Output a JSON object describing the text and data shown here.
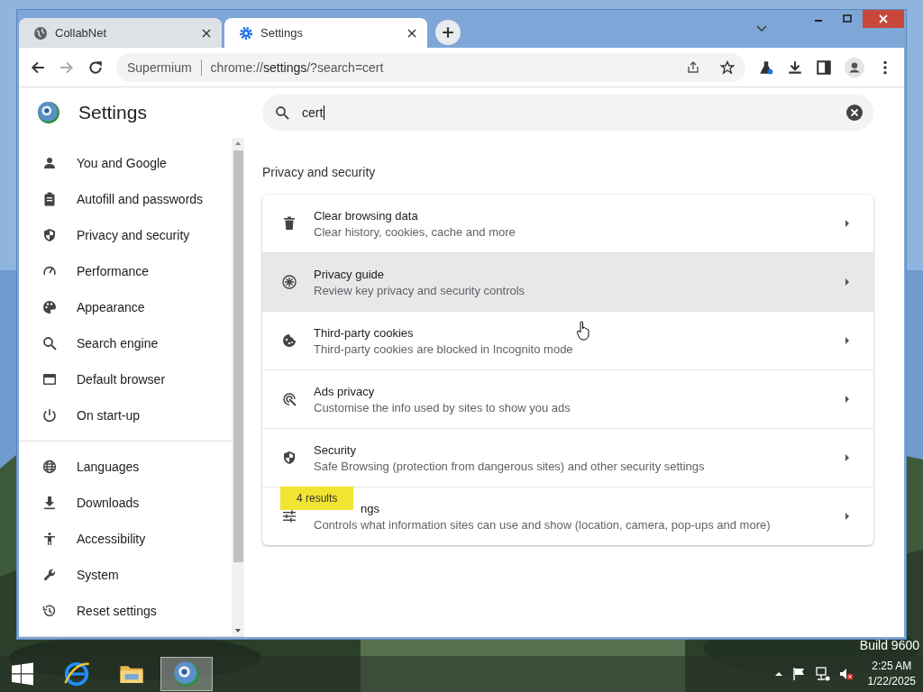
{
  "tabs": [
    {
      "title": "CollabNet",
      "selected": false
    },
    {
      "title": "Settings",
      "selected": true
    }
  ],
  "address_bar": {
    "site": "Supermium",
    "url_prefix": "chrome://",
    "url_host": "settings",
    "url_rest": "/?search=cert"
  },
  "sidebar": {
    "title": "Settings",
    "groups": [
      [
        {
          "label": "You and Google"
        },
        {
          "label": "Autofill and passwords"
        },
        {
          "label": "Privacy and security"
        },
        {
          "label": "Performance"
        },
        {
          "label": "Appearance"
        },
        {
          "label": "Search engine"
        },
        {
          "label": "Default browser"
        },
        {
          "label": "On start-up"
        }
      ],
      [
        {
          "label": "Languages"
        },
        {
          "label": "Downloads"
        },
        {
          "label": "Accessibility"
        },
        {
          "label": "System"
        },
        {
          "label": "Reset settings"
        }
      ]
    ]
  },
  "search": {
    "value": "cert"
  },
  "section": {
    "title": "Privacy and security",
    "rows": [
      {
        "title": "Clear browsing data",
        "subtitle": "Clear history, cookies, cache and more",
        "hovered": false
      },
      {
        "title": "Privacy guide",
        "subtitle": "Review key privacy and security controls",
        "hovered": true
      },
      {
        "title": "Third-party cookies",
        "subtitle": "Third-party cookies are blocked in Incognito mode",
        "hovered": false
      },
      {
        "title": "Ads privacy",
        "subtitle": "Customise the info used by sites to show you ads",
        "hovered": false
      },
      {
        "title": "Security",
        "subtitle": "Safe Browsing (protection from dangerous sites) and other security settings",
        "hovered": false
      },
      {
        "title": "ngs",
        "subtitle": "Controls what information sites can use and show (location, camera, pop-ups and more)",
        "hovered": false,
        "badge": "4 results"
      }
    ]
  },
  "desktop": {
    "build_text": "Build 9600"
  },
  "taskbar": {
    "time": "2:25 AM",
    "date": "1/22/2025"
  }
}
